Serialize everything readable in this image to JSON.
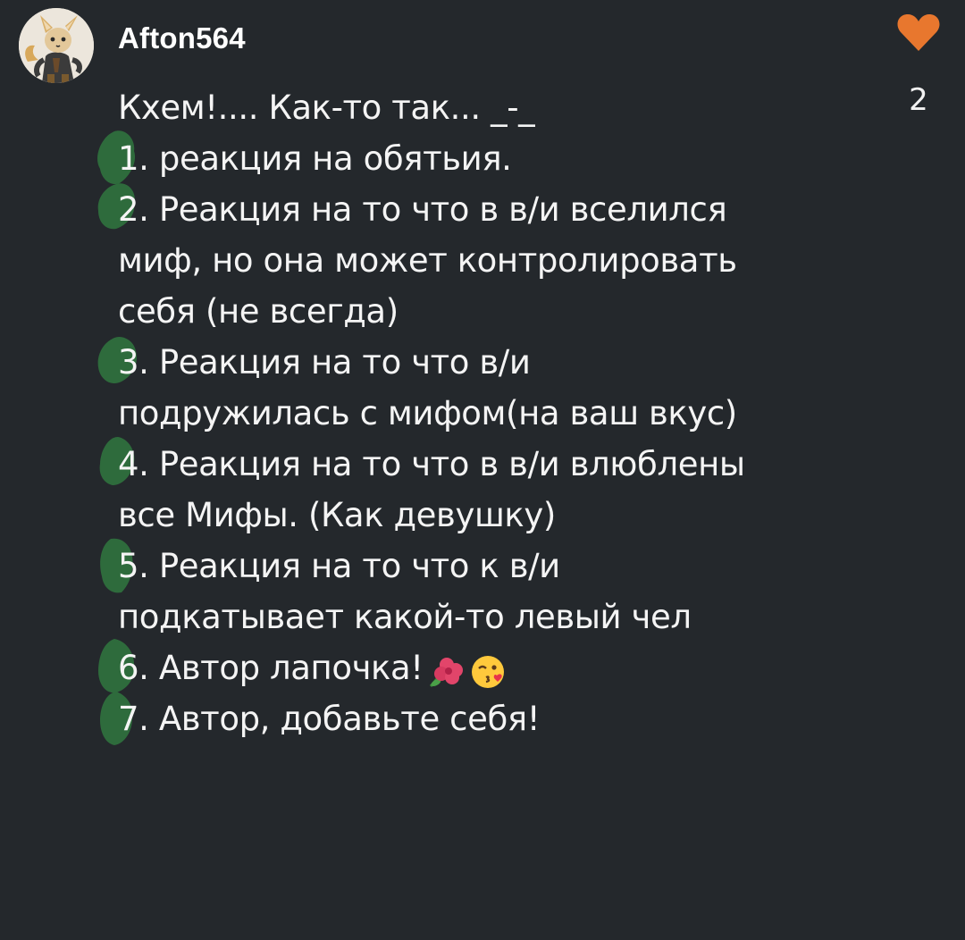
{
  "comment": {
    "author": "Afton564",
    "likes": "2",
    "heart_color": "#e8772e",
    "splash_color": "#2e6b3c",
    "intro": "Кхем!.... Как-то так... _-_",
    "items": [
      {
        "num": "1",
        "lines": [
          ". реакция на обятьия."
        ]
      },
      {
        "num": "2",
        "lines": [
          ". Реакция на то что в в/и вселился",
          "миф, но она может контролировать",
          "себя (не всегда)"
        ]
      },
      {
        "num": "3",
        "lines": [
          ". Реакция на то что в/и",
          "подружилась с мифом(на ваш вкус)"
        ]
      },
      {
        "num": "4",
        "lines": [
          ". Реакция на то что в в/и влюблены",
          "все Мифы. (Как девушку)"
        ]
      },
      {
        "num": "5",
        "lines": [
          ". Реакция на то что к в/и",
          "подкатывает какой-то левый чел"
        ]
      },
      {
        "num": "6",
        "lines": [
          ". Автор лапочка!"
        ],
        "emojis": [
          "hibiscus-emoji",
          "kissing-face-emoji"
        ]
      },
      {
        "num": "7",
        "lines": [
          ". Автор, добавьте себя!"
        ]
      }
    ]
  }
}
